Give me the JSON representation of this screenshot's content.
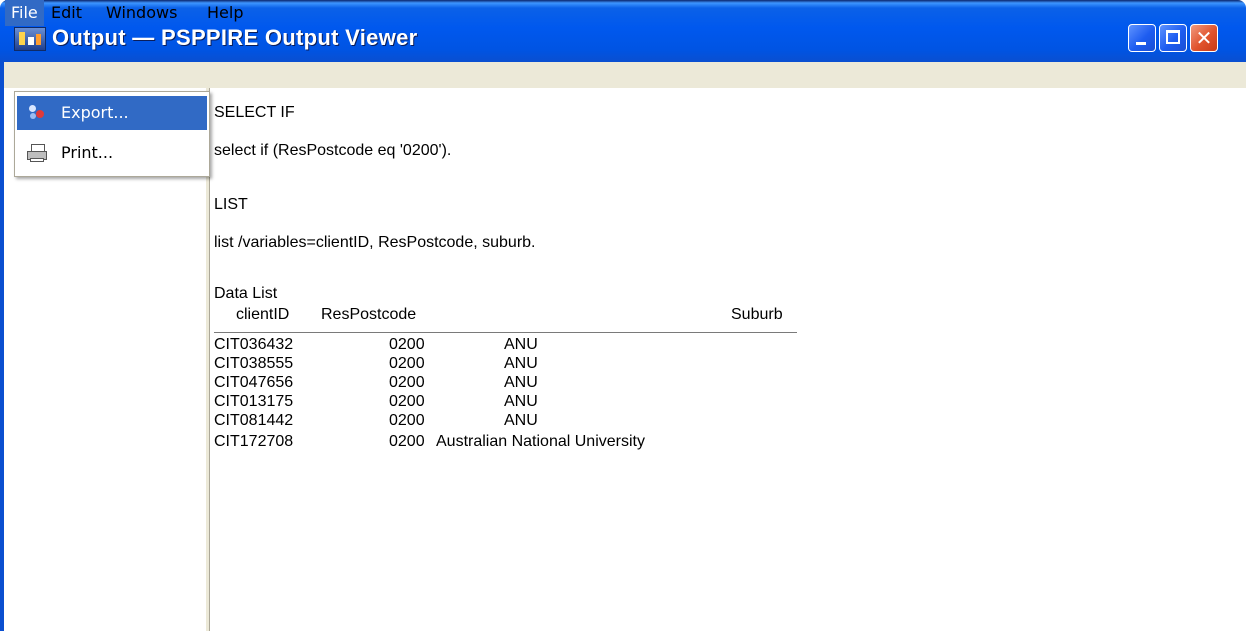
{
  "window": {
    "title": "Output — PSPPIRE Output Viewer"
  },
  "menubar": {
    "items": [
      {
        "label": "File"
      },
      {
        "label": "Edit"
      },
      {
        "label": "Windows"
      },
      {
        "label": "Help"
      }
    ]
  },
  "file_menu": {
    "items": [
      {
        "label": "Export...",
        "icon": "export-icon",
        "highlighted": true
      },
      {
        "label": "Print...",
        "icon": "printer-icon",
        "highlighted": false
      }
    ]
  },
  "output": {
    "select_if_heading": "SELECT IF",
    "select_if_command": "select if (ResPostcode eq '0200').",
    "list_heading": "LIST",
    "list_command": "list /variables=clientID, ResPostcode, suburb.",
    "table": {
      "title": "Data List",
      "columns": [
        "clientID",
        "ResPostcode",
        "Suburb"
      ],
      "rows": [
        [
          "CIT036432",
          "0200",
          "ANU"
        ],
        [
          "CIT038555",
          "0200",
          "ANU"
        ],
        [
          "CIT047656",
          "0200",
          "ANU"
        ],
        [
          "CIT013175",
          "0200",
          "ANU"
        ],
        [
          "CIT081442",
          "0200",
          "ANU"
        ],
        [
          "CIT172708",
          "0200",
          "Australian National University"
        ]
      ]
    }
  },
  "colors": {
    "titlebar": "#0054E3",
    "menu_highlight": "#316AC5",
    "menubar_bg": "#ECE9D8",
    "close_button": "#E0532C"
  }
}
